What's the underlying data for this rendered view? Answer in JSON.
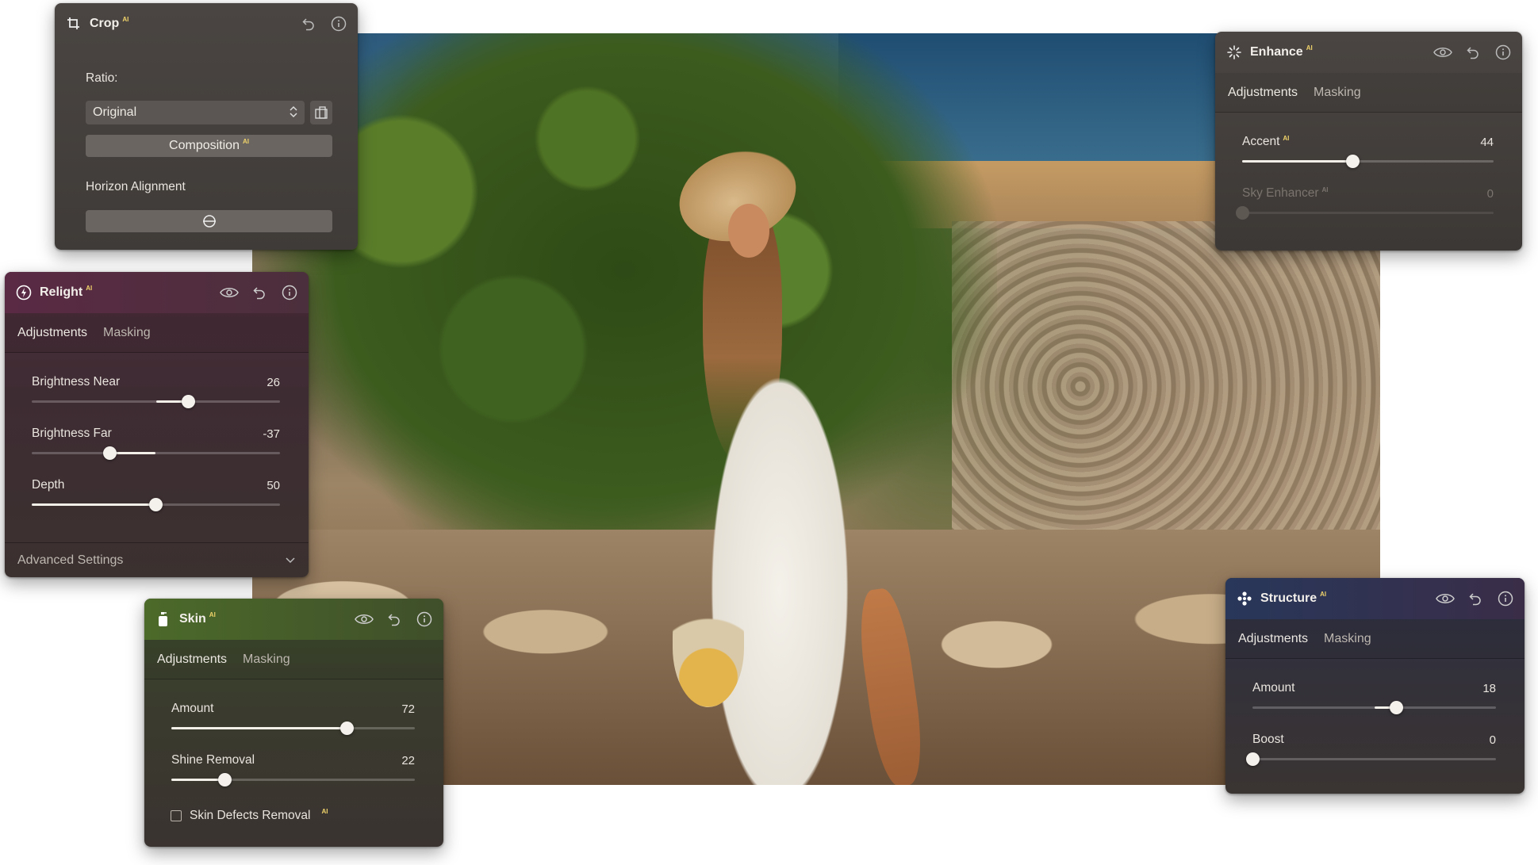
{
  "crop": {
    "title": "Crop",
    "ai_badge": "AI",
    "ratio_label": "Ratio:",
    "ratio_value": "Original",
    "composition_label": "Composition",
    "composition_ai": "AI",
    "horizon_label": "Horizon Alignment"
  },
  "relight": {
    "title": "Relight",
    "ai_badge": "AI",
    "tabs": [
      "Adjustments",
      "Masking"
    ],
    "sliders": [
      {
        "label": "Brightness Near",
        "value": "26",
        "level": 26,
        "min": -100,
        "max": 100
      },
      {
        "label": "Brightness Far",
        "value": "-37",
        "level": -37,
        "min": -100,
        "max": 100
      },
      {
        "label": "Depth",
        "value": "50",
        "level": 50,
        "min": 0,
        "max": 100
      }
    ],
    "advanced_label": "Advanced Settings"
  },
  "enhance": {
    "title": "Enhance",
    "ai_badge": "AI",
    "tabs": [
      "Adjustments",
      "Masking"
    ],
    "sliders": [
      {
        "label": "Accent",
        "ai": "AI",
        "value": "44",
        "level": 44,
        "min": 0,
        "max": 100
      },
      {
        "label": "Sky Enhancer",
        "ai": "AI",
        "value": "0",
        "level": 0,
        "min": 0,
        "max": 100,
        "disabled": true
      }
    ]
  },
  "skin": {
    "title": "Skin",
    "ai_badge": "AI",
    "tabs": [
      "Adjustments",
      "Masking"
    ],
    "sliders": [
      {
        "label": "Amount",
        "value": "72",
        "level": 72,
        "min": 0,
        "max": 100
      },
      {
        "label": "Shine Removal",
        "value": "22",
        "level": 22,
        "min": 0,
        "max": 100
      }
    ],
    "defects_label": "Skin Defects Removal",
    "defects_ai": "AI",
    "defects_checked": false
  },
  "structure": {
    "title": "Structure",
    "ai_badge": "AI",
    "tabs": [
      "Adjustments",
      "Masking"
    ],
    "sliders": [
      {
        "label": "Amount",
        "value": "18",
        "level": 18,
        "min": -100,
        "max": 100
      },
      {
        "label": "Boost",
        "value": "0",
        "level": 0,
        "min": 0,
        "max": 100
      }
    ]
  },
  "colors": {
    "accent_ai": "#f0d36a",
    "relight_header": "#5a2a44",
    "skin_header": "#4c6a2a",
    "structure_header": "#28375a"
  },
  "icons": {
    "crop": "crop-icon",
    "relight": "relight-icon",
    "enhance": "sparkle-icon",
    "skin": "skin-bottle-icon",
    "structure": "structure-icon",
    "visibility": "eye-icon",
    "reset": "undo-icon",
    "info": "info-icon"
  }
}
